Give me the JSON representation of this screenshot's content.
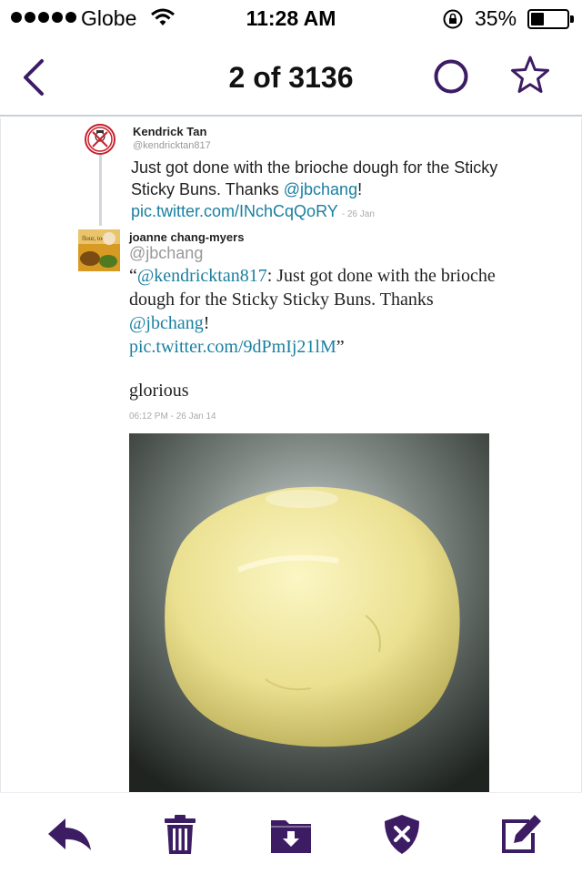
{
  "status_bar": {
    "carrier": "Globe",
    "time": "11:28 AM",
    "battery_percent": "35%",
    "battery_level": 0.35
  },
  "nav": {
    "title": "2 of 3136",
    "accent_color": "#3c1c63"
  },
  "parent_tweet": {
    "name": "Kendrick Tan",
    "handle": "@kendricktan817",
    "text_before": "Just got done with the brioche dough for the Sticky Sticky Buns. Thanks ",
    "mention": "@jbchang",
    "text_after": "!",
    "link": "pic.twitter.com/INchCqQoRY",
    "date": "- 26 Jan"
  },
  "tweet": {
    "name": "joanne chang-myers",
    "handle": "@jbchang",
    "quote_open": "“",
    "quote_mention": "@kendricktan817",
    "quote_text": ": Just got done with the brioche dough for the Sticky Sticky Buns. Thanks ",
    "quote_mention2": "@jbchang",
    "quote_excl": "!",
    "quote_link": "pic.twitter.com/9dPmIj21lM",
    "quote_close": "”",
    "comment": "glorious",
    "timestamp": "06:12 PM - 26 Jan 14"
  },
  "colors": {
    "link": "#1a7fa0",
    "toolbar_icons": "#3c1c63"
  }
}
